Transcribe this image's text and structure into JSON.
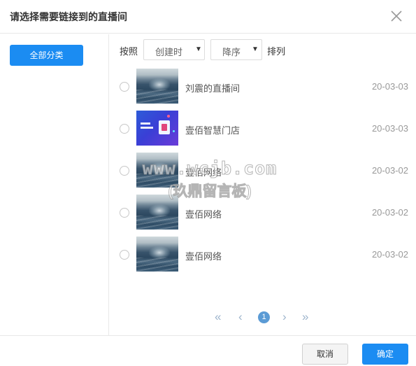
{
  "dialog": {
    "title": "请选择需要链接到的直播间",
    "close_icon": "close-icon"
  },
  "sidebar": {
    "category_button": "全部分类"
  },
  "toolbar": {
    "sort_prefix": "按照",
    "sort_field": "创建时",
    "sort_order": "降序",
    "sort_suffix": "排列",
    "dropdown_icon": "▼"
  },
  "rooms": [
    {
      "name": "刘震的直播间",
      "date": "20-03-03",
      "thumb": "sea-image"
    },
    {
      "name": "壹佰智慧门店",
      "date": "20-03-03",
      "thumb": "store-poster-image"
    },
    {
      "name": "壹佰网络",
      "date": "20-03-02",
      "thumb": "sea-image"
    },
    {
      "name": "壹佰网络",
      "date": "20-03-02",
      "thumb": "sea-image"
    },
    {
      "name": "壹佰网络",
      "date": "20-03-02",
      "thumb": "sea-image"
    }
  ],
  "pagination": {
    "first": "«",
    "prev": "‹",
    "current_page": "1",
    "next": "›",
    "last": "»"
  },
  "watermark": {
    "line1": "www.wcjb.com",
    "line2": "(玖鼎留言板)"
  },
  "footer": {
    "cancel_label": "取消",
    "confirm_label": "确定"
  },
  "colors": {
    "primary": "#1b8cf2",
    "pager": "#9db4cc",
    "page_active": "#5b9bd5"
  }
}
